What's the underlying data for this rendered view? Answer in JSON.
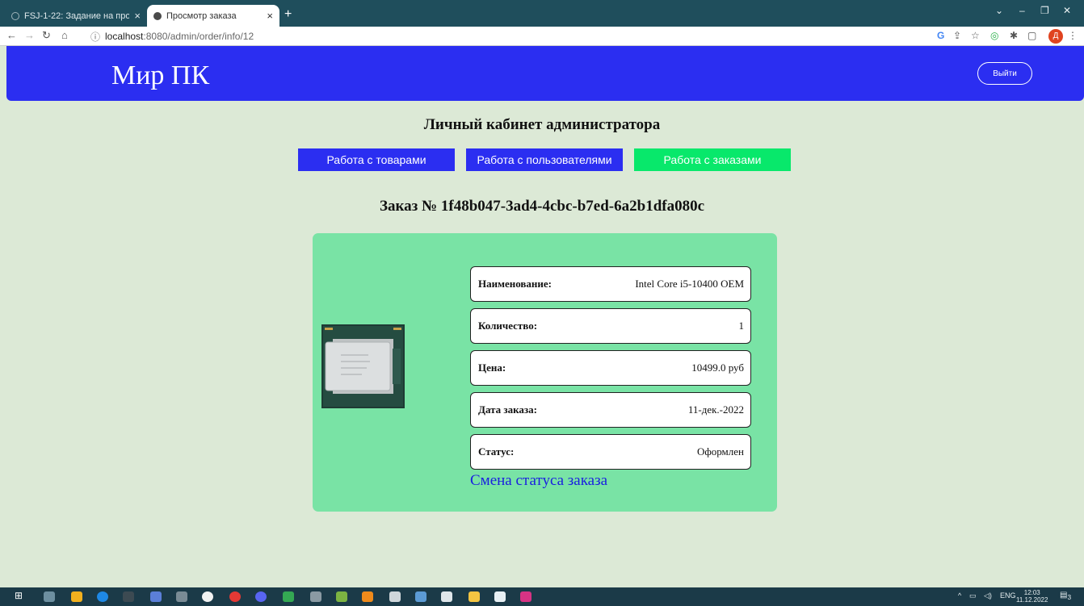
{
  "browser": {
    "tabs": [
      {
        "title": "FSJ-1-22: Задание на промежут",
        "active": false
      },
      {
        "title": "Просмотр заказа",
        "active": true
      }
    ],
    "address": {
      "host": "localhost",
      "rest": ":8080/admin/order/info/12"
    },
    "profile_initial": "Д"
  },
  "header": {
    "logo": "Мир ПК",
    "logout_label": "Выйти"
  },
  "page": {
    "title": "Личный кабинет администратора",
    "nav": {
      "products": "Работа с товарами",
      "users": "Работа с пользователями",
      "orders": "Работа с заказами"
    },
    "order_title": "Заказ № 1f48b047-3ad4-4cbc-b7ed-6a2b1dfa080c"
  },
  "order": {
    "fields": [
      {
        "label": "Наименование:",
        "value": "Intel Core i5-10400 OEM"
      },
      {
        "label": "Количество:",
        "value": "1"
      },
      {
        "label": "Цена:",
        "value": "10499.0 руб"
      },
      {
        "label": "Дата заказа:",
        "value": "11-дек.-2022"
      },
      {
        "label": "Статус:",
        "value": "Оформлен"
      }
    ],
    "change_status_link": "Смена статуса заказа"
  },
  "taskbar": {
    "lang": "ENG",
    "time": "12:03",
    "date": "11.12.2022",
    "notifications": "3"
  },
  "colors": {
    "header_bg": "#2b2ef1",
    "page_bg": "#dce9d6",
    "card_bg": "#79e3a5",
    "active_nav": "#08e86b",
    "link": "#1a1ee0"
  }
}
